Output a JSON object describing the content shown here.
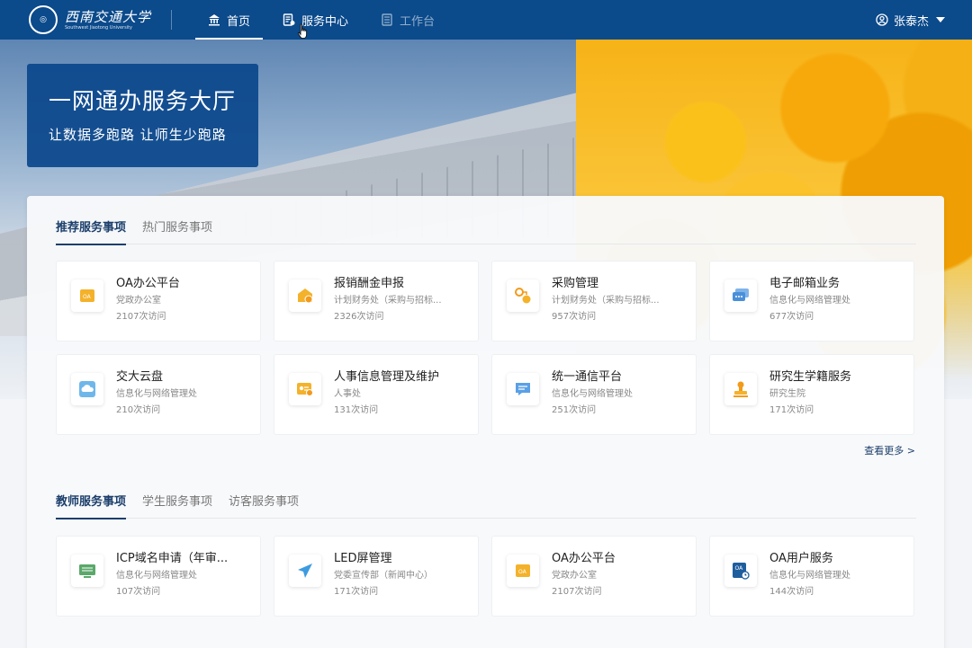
{
  "header": {
    "logo_cn": "西南交通大学",
    "logo_en": "Southwest Jiaotong University",
    "nav": [
      {
        "label": "首页",
        "icon": "bank-icon"
      },
      {
        "label": "服务中心",
        "icon": "service-icon"
      },
      {
        "label": "工作台",
        "icon": "workbench-icon"
      }
    ],
    "user_name": "张泰杰"
  },
  "banner": {
    "title": "一网通办服务大厅",
    "subtitle": "让数据多跑路 让师生少跑路"
  },
  "section1": {
    "tabs": [
      "推荐服务事项",
      "热门服务事项"
    ],
    "more": "查看更多 >",
    "cards": [
      {
        "title": "OA办公平台",
        "dept": "党政办公室",
        "visits": "2107次访问",
        "color": "#f4b22b"
      },
      {
        "title": "报销酬金申报",
        "dept": "计划财务处（采购与招标...",
        "visits": "2326次访问",
        "color": "#f4b22b"
      },
      {
        "title": "采购管理",
        "dept": "计划财务处（采购与招标...",
        "visits": "957次访问",
        "color": "#f4b22b"
      },
      {
        "title": "电子邮箱业务",
        "dept": "信息化与网络管理处",
        "visits": "677次访问",
        "color": "#4a90d9"
      },
      {
        "title": "交大云盘",
        "dept": "信息化与网络管理处",
        "visits": "210次访问",
        "color": "#6fb7ea"
      },
      {
        "title": "人事信息管理及维护",
        "dept": "人事处",
        "visits": "131次访问",
        "color": "#f4b22b"
      },
      {
        "title": "统一通信平台",
        "dept": "信息化与网络管理处",
        "visits": "251次访问",
        "color": "#5aa0e6"
      },
      {
        "title": "研究生学籍服务",
        "dept": "研究生院",
        "visits": "171次访问",
        "color": "#f29a1a"
      }
    ]
  },
  "section2": {
    "tabs": [
      "教师服务事项",
      "学生服务事项",
      "访客服务事项"
    ],
    "cards": [
      {
        "title": "ICP域名申请（年审...",
        "dept": "信息化与网络管理处",
        "visits": "107次访问",
        "color": "#5aa86a"
      },
      {
        "title": "LED屏管理",
        "dept": "党委宣传部（新闻中心）",
        "visits": "171次访问",
        "color": "#3d9be0"
      },
      {
        "title": "OA办公平台",
        "dept": "党政办公室",
        "visits": "2107次访问",
        "color": "#f4b22b"
      },
      {
        "title": "OA用户服务",
        "dept": "信息化与网络管理处",
        "visits": "144次访问",
        "color": "#1f5e9e"
      }
    ]
  }
}
